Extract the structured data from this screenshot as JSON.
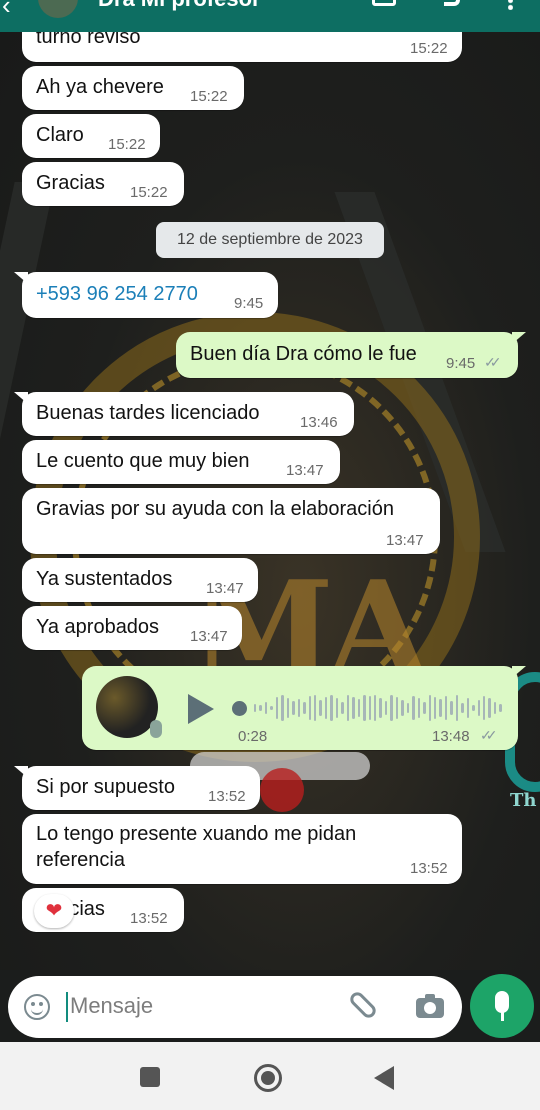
{
  "header": {
    "contact_name": "Dra Mi profesor"
  },
  "date_divider": "12 de septiembre de 2023",
  "messages": [
    {
      "dir": "in",
      "text": "turno reviso",
      "time": "15:22"
    },
    {
      "dir": "in",
      "text": "Ah ya chevere",
      "time": "15:22"
    },
    {
      "dir": "in",
      "text": "Claro",
      "time": "15:22"
    },
    {
      "dir": "in",
      "text": "Gracias",
      "time": "15:22"
    },
    {
      "dir": "in",
      "text": "+593 96 254 2770",
      "time": "9:45"
    },
    {
      "dir": "out",
      "text": "Buen día Dra cómo le fue",
      "time": "9:45"
    },
    {
      "dir": "in",
      "text": "Buenas tardes licenciado",
      "time": "13:46"
    },
    {
      "dir": "in",
      "text": "Le cuento que muy bien",
      "time": "13:47"
    },
    {
      "dir": "in",
      "text": "Gravias por su ayuda con la elaboración",
      "time": "13:47"
    },
    {
      "dir": "in",
      "text": "Ya sustentados",
      "time": "13:47"
    },
    {
      "dir": "in",
      "text": "Ya aprobados",
      "time": "13:47"
    },
    {
      "dir": "in",
      "text": "Si por supuesto",
      "time": "13:52"
    },
    {
      "dir": "in",
      "text_line1": "Lo tengo presente xuando me pidan",
      "text_line2": "referencia",
      "time": "13:52"
    },
    {
      "dir": "in",
      "text": "Gracias",
      "time": "13:52"
    }
  ],
  "voice_note": {
    "duration": "0:28",
    "time": "13:48",
    "ticks": "✓✓"
  },
  "reaction": "❤",
  "out_ticks": "✓✓",
  "input": {
    "placeholder": "Mensaje"
  },
  "icons": [
    "back-arrow-icon",
    "video-call-icon",
    "phone-call-icon",
    "menu-icon",
    "emoji-icon",
    "attach-icon",
    "camera-icon",
    "mic-icon",
    "nav-recents-icon",
    "nav-home-icon",
    "nav-back-icon"
  ],
  "colors": {
    "header": "#0d6e62",
    "incoming_bubble": "#ffffff",
    "outgoing_bubble": "#dcf9c6",
    "mic_button": "#1da468",
    "phone_link": "#1b7fb8"
  }
}
